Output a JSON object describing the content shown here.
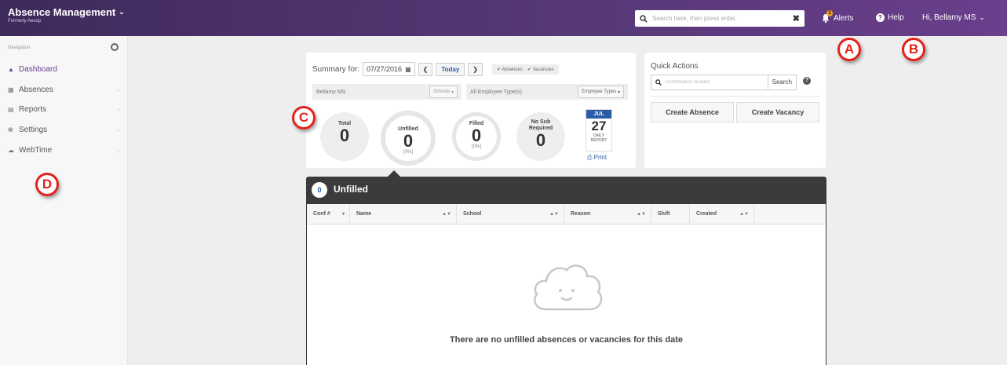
{
  "header": {
    "app_title": "Absence Management",
    "app_subtitle": "Formerly Aesop",
    "search_placeholder": "Search here, then press enter.",
    "alerts_label": "Alerts",
    "alerts_badge": "1",
    "help_label": "Help",
    "user_label": "Hi, Bellamy MS"
  },
  "sidebar": {
    "heading": "Navigation",
    "items": [
      {
        "label": "Dashboard",
        "icon": "dashboard-icon"
      },
      {
        "label": "Absences",
        "icon": "calendar-icon"
      },
      {
        "label": "Reports",
        "icon": "chart-icon"
      },
      {
        "label": "Settings",
        "icon": "gear-icon"
      },
      {
        "label": "WebTime",
        "icon": "cloud-icon"
      }
    ]
  },
  "markers": {
    "a": "A",
    "b": "B",
    "c": "C",
    "d": "D"
  },
  "summary": {
    "label": "Summary for:",
    "date": "07/27/2016",
    "today_label": "Today",
    "chk_absences": "Absences",
    "chk_vacancies": "Vacancies",
    "location": "Bellamy MS",
    "schools_btn": "Schools",
    "employee_type": "All Employee Type(s)",
    "employee_types_btn": "Employee Types",
    "stats": {
      "total_label": "Total",
      "total_value": "0",
      "unfilled_label": "Unfilled",
      "unfilled_value": "0",
      "unfilled_pct": "[0%]",
      "filled_label": "Filled",
      "filled_value": "0",
      "filled_pct": "[0%]",
      "nosub_label1": "No Sub",
      "nosub_label2": "Required",
      "nosub_value": "0"
    },
    "calendar": {
      "month": "JUL",
      "day": "27",
      "line1": "DAILY",
      "line2": "REPORT"
    },
    "print_label": "Print"
  },
  "quick_actions": {
    "title": "Quick Actions",
    "confirmation_placeholder": "Confirmation Number",
    "search_btn": "Search",
    "create_absence": "Create Absence",
    "create_vacancy": "Create Vacancy"
  },
  "unfilled": {
    "count": "0",
    "title": "Unfilled",
    "columns": [
      "Conf #",
      "Name",
      "School",
      "Reason",
      "Shift",
      "Created"
    ],
    "empty_message": "There are no unfilled absences or vacancies for this date"
  }
}
